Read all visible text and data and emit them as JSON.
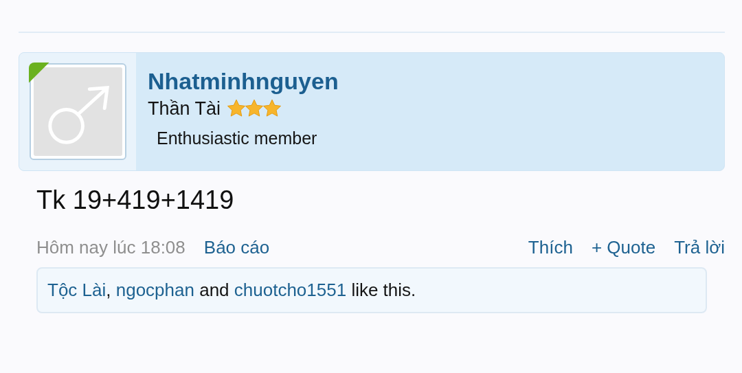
{
  "post": {
    "author": {
      "name": "Nhatminhnguyen",
      "online": true,
      "title": "Thần Tài",
      "stars": 3,
      "rank": "Enthusiastic member"
    },
    "message": "Tk 19+419+1419",
    "time": "Hôm nay lúc 18:08",
    "report": "Báo cáo",
    "actions": [
      "Thích",
      "+ Quote",
      "Trả lời"
    ],
    "likes": [
      {
        "name": "Tộc Lài",
        "suffix": ", "
      },
      {
        "name": "ngocphan",
        "suffix": " and "
      },
      {
        "name": "chuotcho1551",
        "suffix": " like this."
      }
    ]
  }
}
